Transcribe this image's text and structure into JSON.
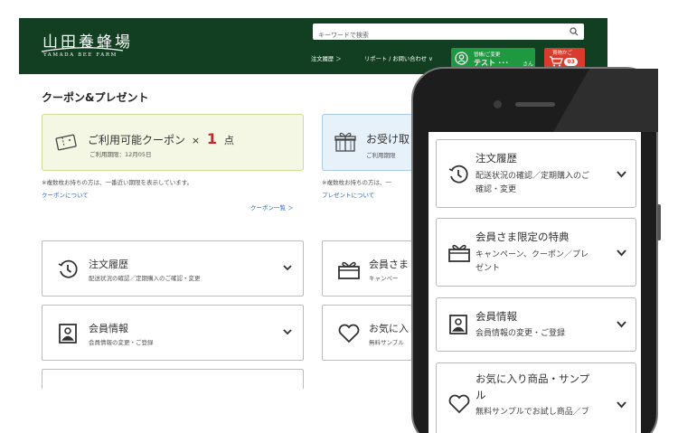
{
  "header": {
    "logo_main": "山田養蜂場",
    "logo_sub": "YAMADA BEE FARM",
    "search_placeholder": "キーワードで検索",
    "nav_order_history": "注文履歴 ＞",
    "nav_support": "リポート / お問い合わせ ∨",
    "member_label": "冒帳/ご変更",
    "member_name": "テスト ･･･",
    "member_suffix": "さん",
    "cart_label": "買物かご",
    "cart_count": "03"
  },
  "page": {
    "section_title": "クーポン&プレゼント",
    "coupon": {
      "title": "ご利用可能クーポン",
      "times": "×",
      "count": "1",
      "unit": "点",
      "sub": "ご利用期限：12月05日"
    },
    "present": {
      "title": "お受け取",
      "sub": "ご利用期限"
    },
    "coupon_note": "※複数枚お持ちの方は、一番近い期限を表示しています。",
    "coupon_link": "クーポンについて",
    "coupon_list_link": "クーポン一覧 ＞",
    "present_note": "※複数枚お持ちの方は、一",
    "present_link": "プレゼントについて"
  },
  "desktop_menu": [
    {
      "title": "注文履歴",
      "sub": "配送状況の確認／定期購入のご確認・変更",
      "icon": "clock-history-icon"
    },
    {
      "title": "会員さま",
      "sub": "キャンペー",
      "icon": "gift-box-icon"
    },
    {
      "title": "会員情報",
      "sub": "会員情報の変更・ご登録",
      "icon": "member-card-icon"
    },
    {
      "title": "お気に入",
      "sub": "無料サンプル",
      "icon": "heart-icon"
    }
  ],
  "mobile_menu": [
    {
      "title": "注文履歴",
      "sub_lines": [
        "配送状況の確認／定期購入のご",
        "確認・変更"
      ],
      "icon": "clock-history-icon"
    },
    {
      "title": "会員さま限定の特典",
      "sub_lines": [
        "キャンペーン、クーポン／プレ",
        "ゼント"
      ],
      "icon": "gift-box-icon"
    },
    {
      "title": "会員情報",
      "sub_lines": [
        "会員情報の変更・ご登録"
      ],
      "icon": "member-card-icon"
    },
    {
      "title_lines": [
        "お気に入り商品・サンプ",
        "ル"
      ],
      "sub_lines": [
        "無料サンプルでお試し商品／ブ"
      ],
      "icon": "heart-icon"
    }
  ],
  "colors": {
    "header_bg": "#123f22",
    "member_btn": "#1e9940",
    "cart_btn": "#d93b2c",
    "coupon_count": "#c8242f",
    "link": "#2a63b0"
  }
}
